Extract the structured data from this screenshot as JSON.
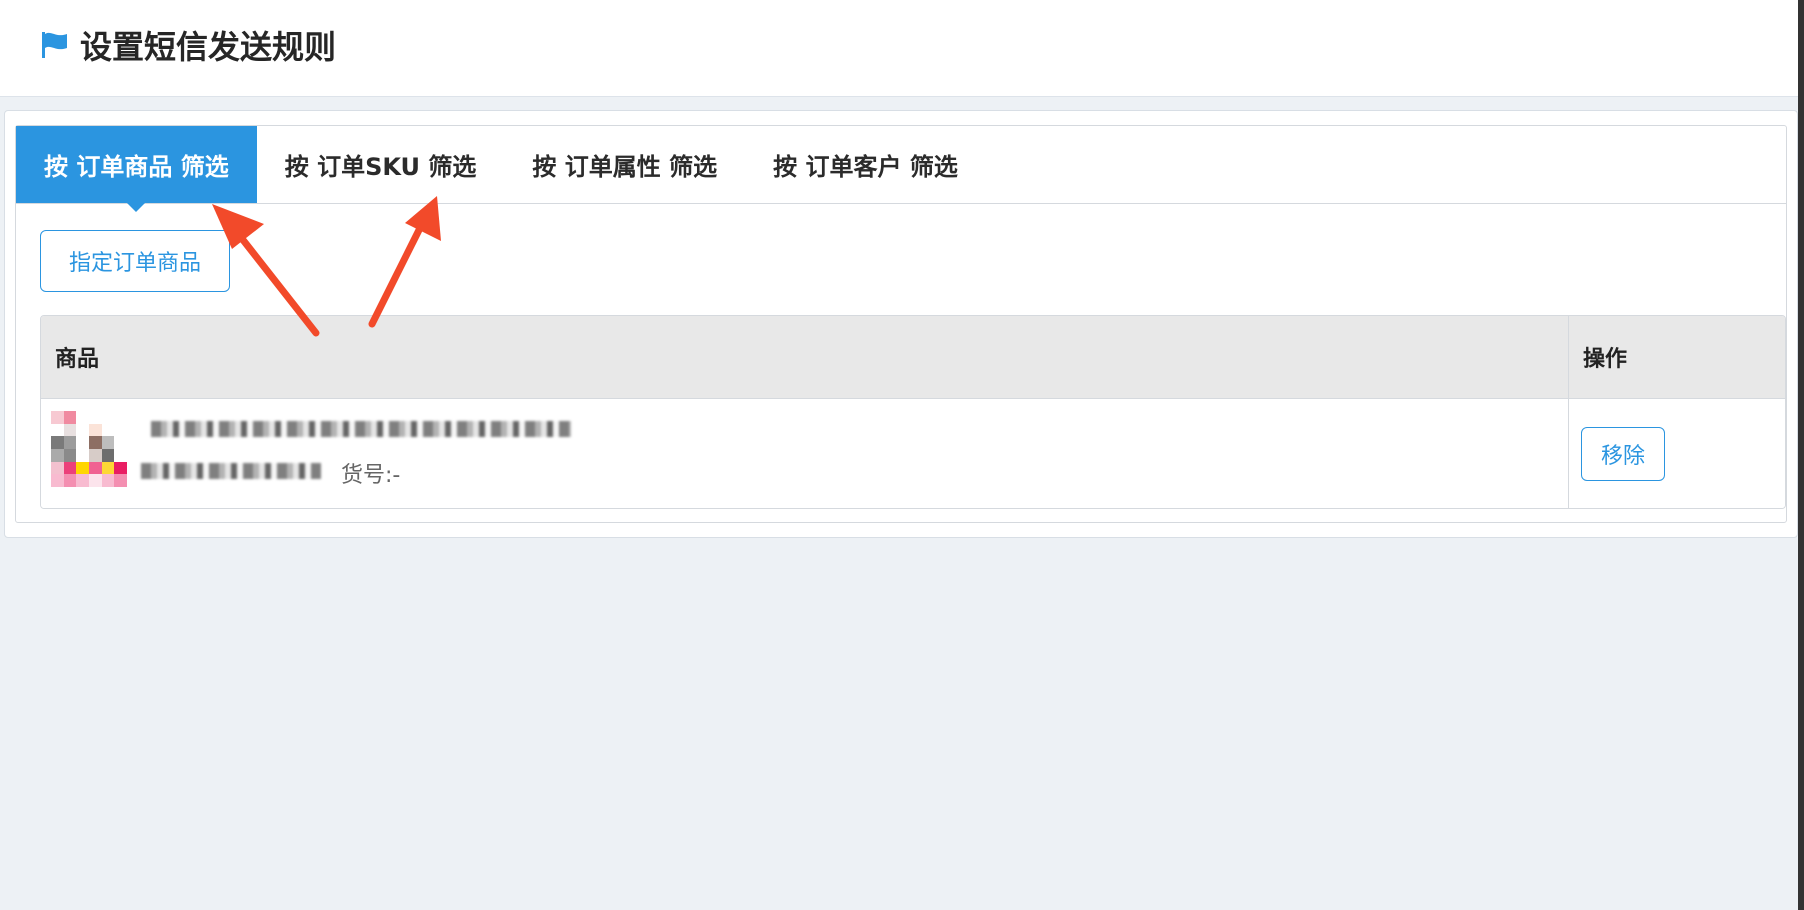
{
  "header": {
    "icon": "flag-icon",
    "title": "设置短信发送规则"
  },
  "tabs": [
    {
      "label": "按 订单商品 筛选",
      "active": true
    },
    {
      "label": "按 订单SKU 筛选",
      "active": false
    },
    {
      "label": "按 订单属性 筛选",
      "active": false
    },
    {
      "label": "按 订单客户 筛选",
      "active": false
    }
  ],
  "assign_button": "指定订单商品",
  "table": {
    "columns": [
      "商品",
      "操作"
    ],
    "rows": [
      {
        "thumbnail_icon": "product-thumbnail-icon",
        "meta": "货号:-",
        "action_label": "移除"
      }
    ]
  },
  "colors": {
    "accent": "#2b95e0",
    "annotation_arrow": "#f24a2a",
    "page_background": "#edf1f5"
  }
}
